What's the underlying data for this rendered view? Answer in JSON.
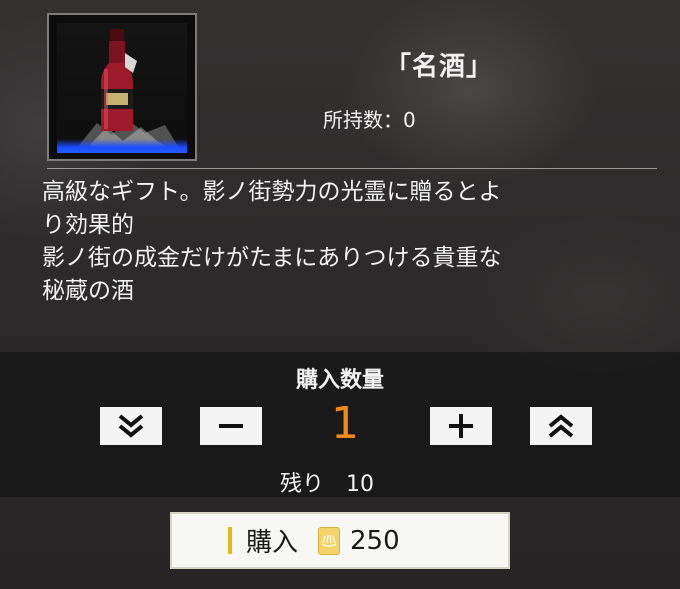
{
  "item": {
    "name": "「名酒」",
    "owned_label": "所持数：0",
    "image_icon": "wine-bottle-icon",
    "description": [
      "高級なギフト。影ノ街勢力の光霊に贈るとよ",
      "り効果的",
      "影ノ街の成金だけがたまにありつける貴重な",
      "秘蔵の酒"
    ]
  },
  "purchase_panel": {
    "title": "購入数量",
    "quantity": "1",
    "remaining_label": "残り",
    "remaining_value": "10",
    "buttons": {
      "min": "chevron-double-down-icon",
      "decrease": "minus-icon",
      "increase": "plus-icon",
      "max": "chevron-double-up-icon"
    }
  },
  "buy_button": {
    "label": "購入",
    "currency_icon": "coin-icon",
    "price": "250"
  },
  "colors": {
    "quantity": "#f08a1a",
    "accent_bar": "#e6b81e",
    "item_glow": "#1a4cff"
  }
}
